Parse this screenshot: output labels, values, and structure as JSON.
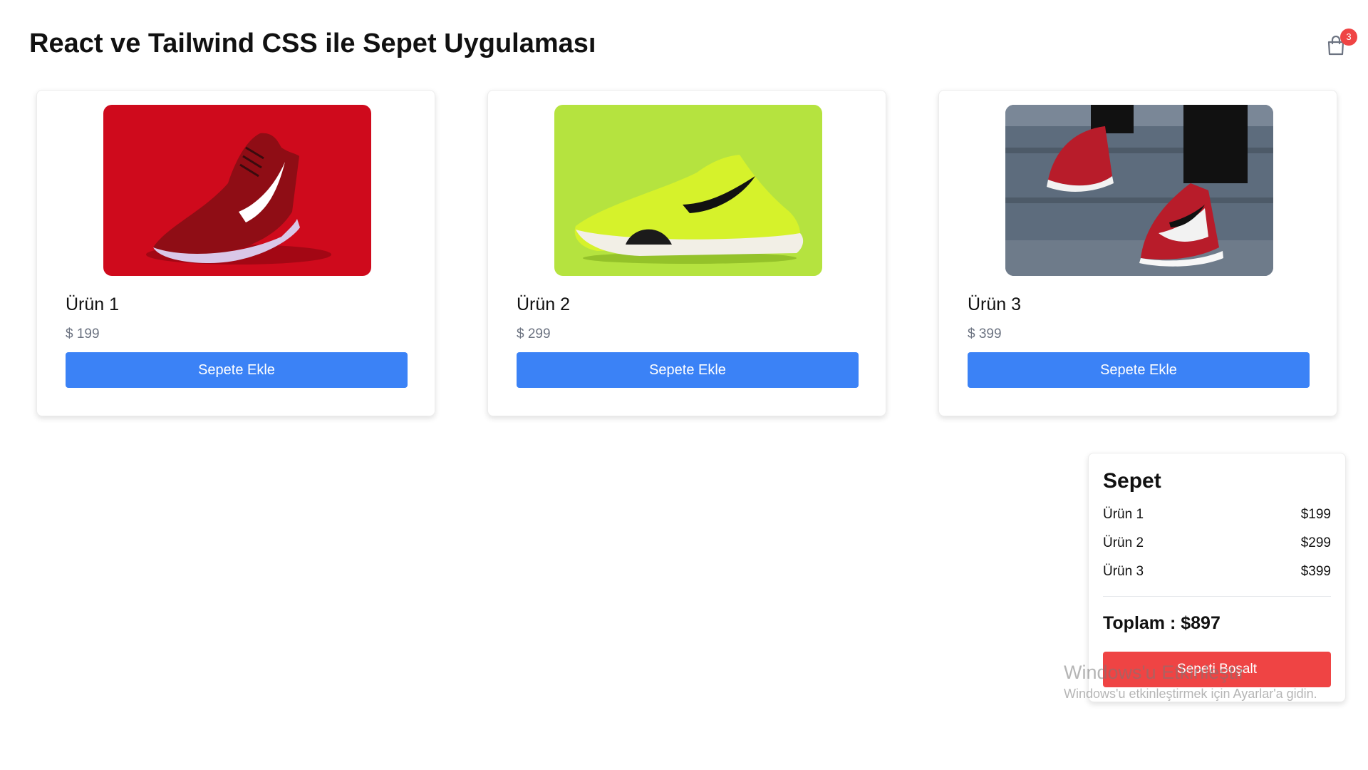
{
  "header": {
    "title": "React ve Tailwind CSS ile Sepet Uygulaması",
    "cart_count": "3",
    "cart_icon": "shopping-bag-icon"
  },
  "products": [
    {
      "name": "Ürün 1",
      "price": "$ 199",
      "button_label": "Sepete Ekle",
      "image": "red-running-shoe-photo"
    },
    {
      "name": "Ürün 2",
      "price": "$ 299",
      "button_label": "Sepete Ekle",
      "image": "neon-green-sneaker-photo"
    },
    {
      "name": "Ürün 3",
      "price": "$ 399",
      "button_label": "Sepete Ekle",
      "image": "red-white-high-top-sneakers-photo"
    }
  ],
  "cart": {
    "title": "Sepet",
    "items": [
      {
        "name": "Ürün 1",
        "price": "$199"
      },
      {
        "name": "Ürün 2",
        "price": "$299"
      },
      {
        "name": "Ürün 3",
        "price": "$399"
      }
    ],
    "total": "Toplam : $897",
    "clear_label": "Sepeti Boşalt"
  },
  "watermark": {
    "line1": "Windows'u Etkinleştir",
    "line2": "Windows'u etkinleştirmek için Ayarlar'a gidin."
  },
  "colors": {
    "primary_button": "#3b82f6",
    "danger_button": "#ef4444",
    "badge": "#ef4444",
    "price_text": "#6b7280"
  }
}
